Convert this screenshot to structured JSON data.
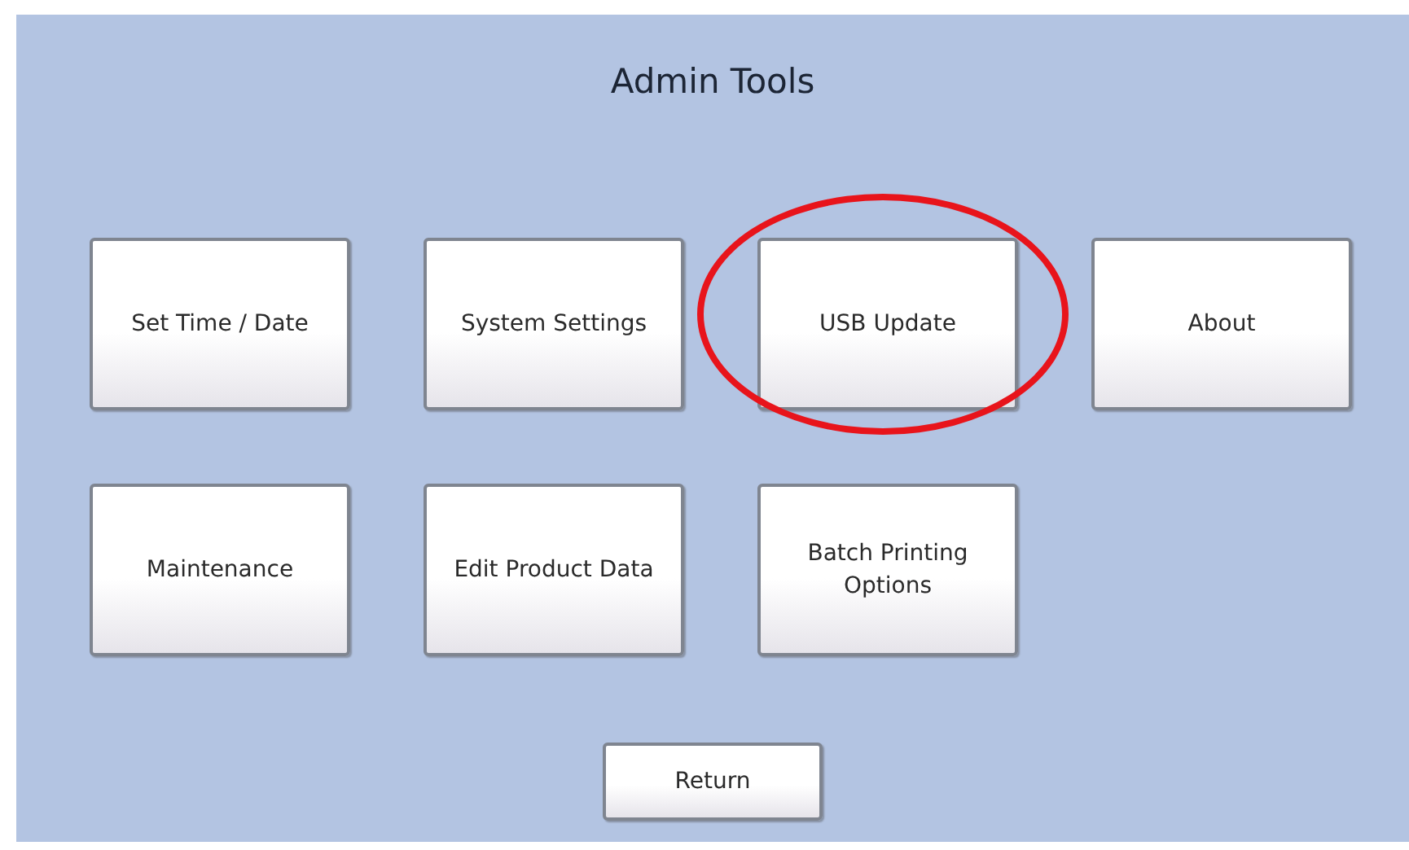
{
  "title": "Admin Tools",
  "buttons": [
    {
      "label": "Set Time / Date",
      "circled": false
    },
    {
      "label": "System Settings",
      "circled": false
    },
    {
      "label": "USB Update",
      "circled": true
    },
    {
      "label": "About",
      "circled": false
    },
    {
      "label": "Maintenance",
      "circled": false
    },
    {
      "label": "Edit Product Data",
      "circled": false
    },
    {
      "label": "Batch Printing Options",
      "circled": false
    }
  ],
  "return_button": "Return"
}
